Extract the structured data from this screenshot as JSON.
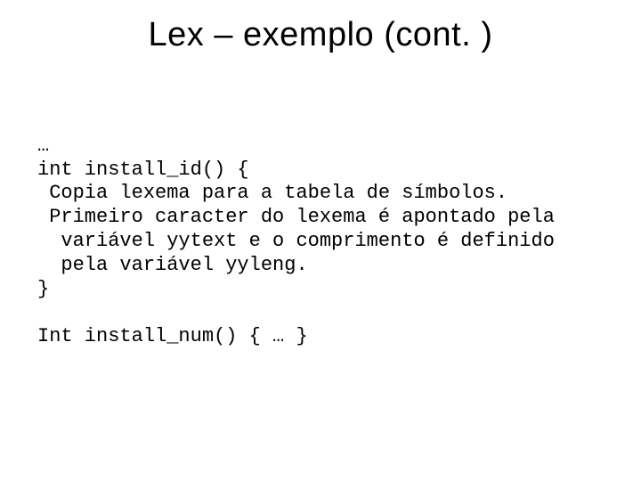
{
  "title": "Lex – exemplo (cont. )",
  "code": {
    "l1": "…",
    "l2": "int install_id() {",
    "l3": " Copia lexema para a tabela de símbolos.",
    "l4": " Primeiro caracter do lexema é apontado pela",
    "l5": "  variável yytext e o comprimento é definido",
    "l6": "  pela variável yyleng.",
    "l7": "}",
    "l8": "Int install_num() { … }"
  }
}
